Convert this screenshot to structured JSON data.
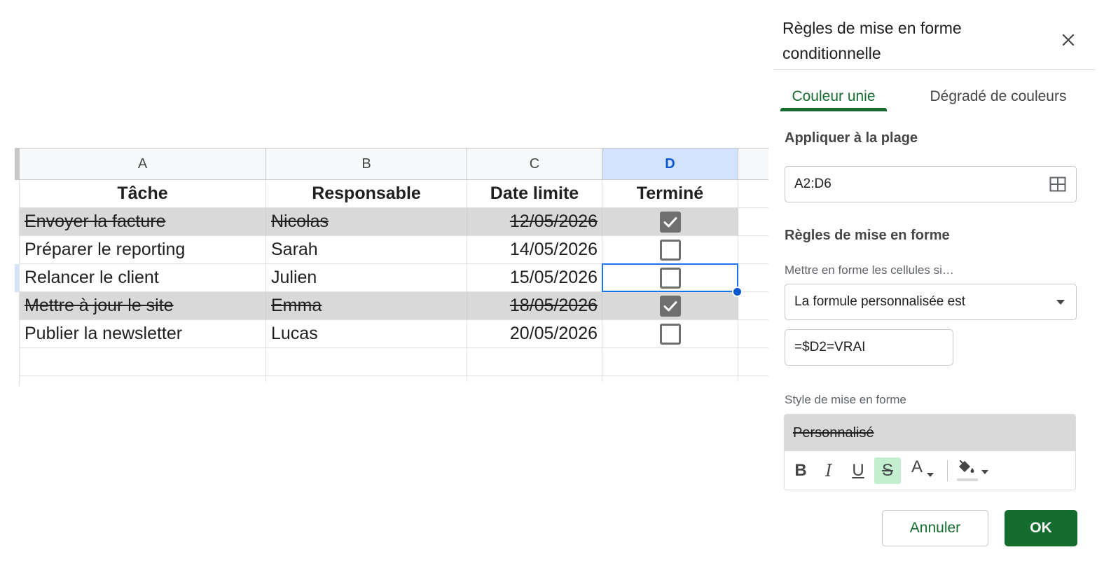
{
  "sheet": {
    "columns": [
      {
        "letter": "A",
        "selected": false
      },
      {
        "letter": "B",
        "selected": false
      },
      {
        "letter": "C",
        "selected": false
      },
      {
        "letter": "D",
        "selected": true
      }
    ],
    "header": {
      "task": "Tâche",
      "owner": "Responsable",
      "deadline": "Date limite",
      "done": "Terminé"
    },
    "rows": [
      {
        "task": "Envoyer la facture",
        "owner": "Nicolas",
        "deadline": "12/05/2026",
        "done": true
      },
      {
        "task": "Préparer le reporting",
        "owner": "Sarah",
        "deadline": "14/05/2026",
        "done": false
      },
      {
        "task": "Relancer le client",
        "owner": "Julien",
        "deadline": "15/05/2026",
        "done": false
      },
      {
        "task": "Mettre à jour le site",
        "owner": "Emma",
        "deadline": "18/05/2026",
        "done": true
      },
      {
        "task": "Publier la newsletter",
        "owner": "Lucas",
        "deadline": "20/05/2026",
        "done": false
      }
    ]
  },
  "panel": {
    "title": "Règles de mise en forme conditionnelle",
    "tabs": {
      "solid": "Couleur unie",
      "gradient": "Dégradé de couleurs",
      "active": "solid"
    },
    "apply_range_title": "Appliquer à la plage",
    "range_value": "A2:D6",
    "rules_title": "Règles de mise en forme",
    "condition_label": "Mettre en forme les cellules si…",
    "condition_value": "La formule personnalisée est",
    "formula_value": "=$D2=VRAI",
    "style_label": "Style de mise en forme",
    "style_preview": "Personnalisé",
    "toolbar": {
      "bold": "B",
      "italic": "I",
      "underline": "U",
      "strike": "S",
      "text_color": "A",
      "strike_active": true
    },
    "cancel_label": "Annuler",
    "ok_label": "OK"
  },
  "colors": {
    "accent": "#146c2e",
    "selection": "#1a73e8",
    "done_row_fill": "#d9d9d9",
    "strike_active_bg": "#c4eed0"
  }
}
